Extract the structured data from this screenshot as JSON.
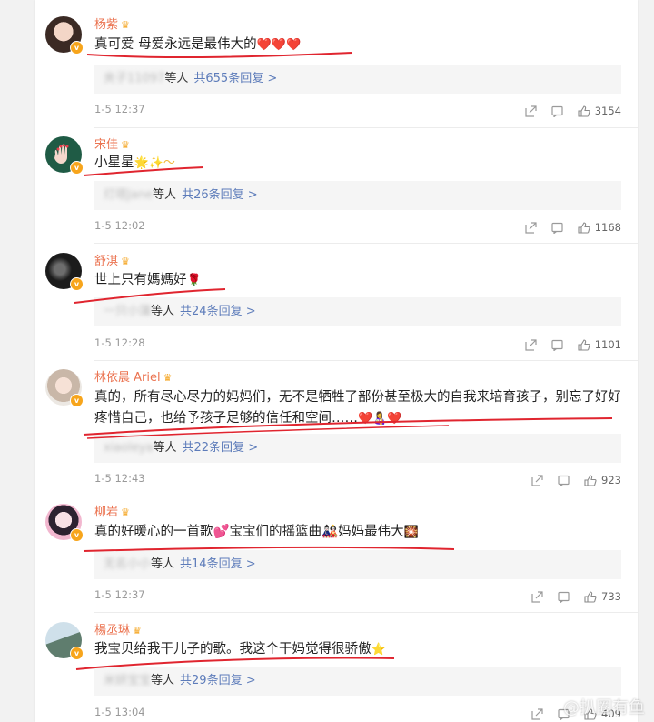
{
  "comments": [
    {
      "name": "杨紫",
      "text": "真可爱 母爱永远是最伟大的",
      "emoji": "❤️❤️❤️",
      "reply_user": "夹子11097",
      "reply_suffix": "等人",
      "reply_count": "共655条回复 >",
      "time": "1-5 12:37",
      "likes": "3154"
    },
    {
      "name": "宋佳",
      "text": "小星星",
      "emoji": "🌟✨～",
      "reply_user": "灯塔Jane",
      "reply_suffix": "等人",
      "reply_count": "共26条回复 >",
      "time": "1-5 12:02",
      "likes": "1168"
    },
    {
      "name": "舒淇",
      "text": "世上只有媽媽好",
      "emoji": "🌹",
      "reply_user": "一只小蒲",
      "reply_suffix": "等人",
      "reply_count": "共24条回复 >",
      "time": "1-5 12:28",
      "likes": "1101"
    },
    {
      "name": "林依晨 Ariel",
      "text": "真的，所有尽心尽力的妈妈们，无不是牺牲了部份甚至极大的自我来培育孩子，别忘了好好疼惜自己，也给予孩子足够的信任和空间……",
      "emoji": "❤️👩‍🍼❤️",
      "reply_user": "xiaoleya",
      "reply_suffix": "等人",
      "reply_count": "共22条回复 >",
      "time": "1-5 12:43",
      "likes": "923"
    },
    {
      "name": "柳岩",
      "text": "真的好暖心的一首歌💕宝宝们的摇篮曲🎎妈妈最伟大",
      "emoji": "🎇",
      "reply_user": "无名小小",
      "reply_suffix": "等人",
      "reply_count": "共14条回复 >",
      "time": "1-5 12:37",
      "likes": "733"
    },
    {
      "name": "楊丞琳",
      "text": "我宝贝给我干儿子的歌。我这个干妈觉得很骄傲",
      "emoji": "⭐",
      "reply_user": "米妍宝宝",
      "reply_suffix": "等人",
      "reply_count": "共29条回复 >",
      "time": "1-5 13:04",
      "likes": "409"
    }
  ],
  "watermark": "@扒圈有鱼",
  "icons": {
    "share": "share-icon",
    "comment": "comment-icon",
    "like": "thumbs-up-icon",
    "verified": "verified-v-badge-icon",
    "crown": "crown-member-icon"
  },
  "colors": {
    "name": "#eb7350",
    "link": "#5d7cba",
    "underline": "#e0252f",
    "badge": "#f7a51c"
  }
}
